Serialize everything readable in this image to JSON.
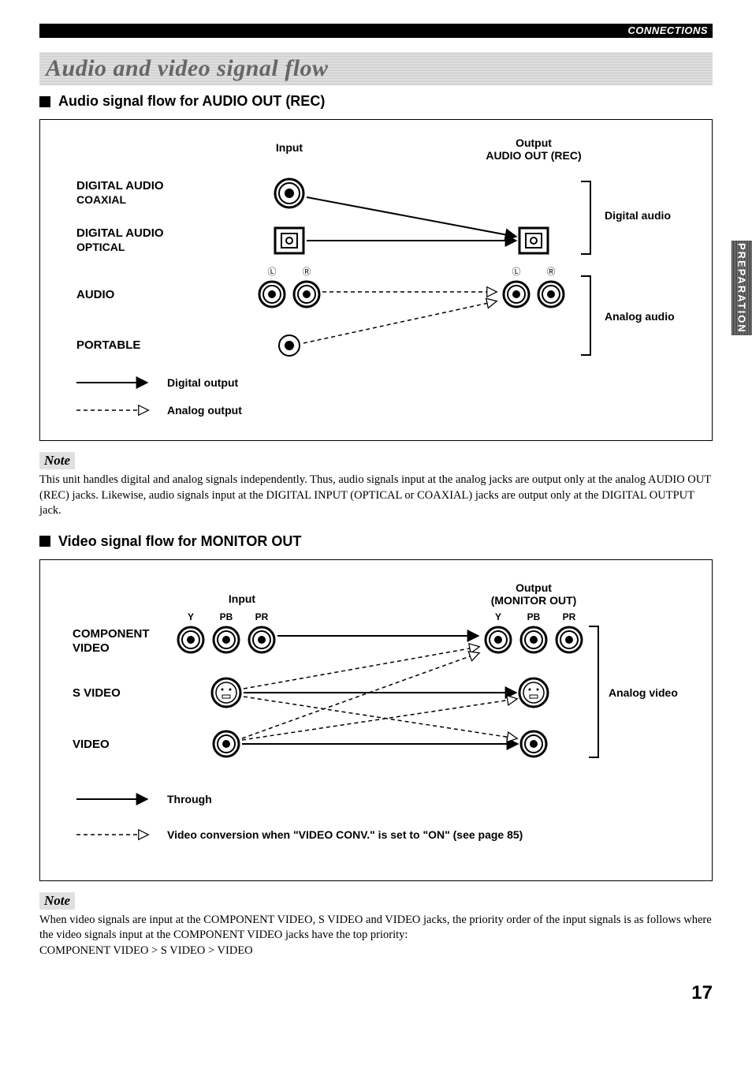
{
  "header": {
    "section": "CONNECTIONS"
  },
  "banner": {
    "title": "Audio and video signal flow"
  },
  "audio": {
    "heading": "Audio signal flow for AUDIO OUT (REC)",
    "input_label": "Input",
    "output_label_line1": "Output",
    "output_label_line2": "AUDIO OUT (REC)",
    "rows": {
      "r1_line1": "DIGITAL AUDIO",
      "r1_line2": "COAXIAL",
      "r2_line1": "DIGITAL AUDIO",
      "r2_line2": "OPTICAL",
      "r3": "AUDIO",
      "r4": "PORTABLE"
    },
    "right": {
      "digital": "Digital audio",
      "analog": "Analog audio"
    },
    "legend": {
      "digital": "Digital output",
      "analog": "Analog output"
    },
    "lr": {
      "l": "L",
      "r": "R"
    }
  },
  "audio_note": {
    "label": "Note",
    "body": "This unit handles digital and analog signals independently. Thus, audio signals input at the analog jacks are output only at the analog AUDIO OUT (REC) jacks. Likewise, audio signals input at the DIGITAL INPUT (OPTICAL or COAXIAL) jacks are output only at the DIGITAL OUTPUT jack."
  },
  "video": {
    "heading": "Video signal flow for MONITOR OUT",
    "input_label": "Input",
    "output_label_line1": "Output",
    "output_label_line2": "(MONITOR OUT)",
    "rows": {
      "r1_line1": "COMPONENT",
      "r1_line2": "VIDEO",
      "r2": "S VIDEO",
      "r3": "VIDEO"
    },
    "comp": {
      "y": "Y",
      "pb": "PB",
      "pr": "PR"
    },
    "right": {
      "analog": "Analog video"
    },
    "legend": {
      "through": "Through",
      "conv": "Video conversion when \"VIDEO CONV.\" is set to \"ON\" (see page 85)"
    }
  },
  "video_note": {
    "label": "Note",
    "body": "When video signals are input at the COMPONENT VIDEO, S VIDEO and VIDEO jacks, the priority order of the input signals is as follows where the video signals input at the COMPONENT VIDEO jacks have the top priority:",
    "body2": "COMPONENT VIDEO > S VIDEO > VIDEO"
  },
  "side_tab": "PREPARATION",
  "page_number": "17"
}
